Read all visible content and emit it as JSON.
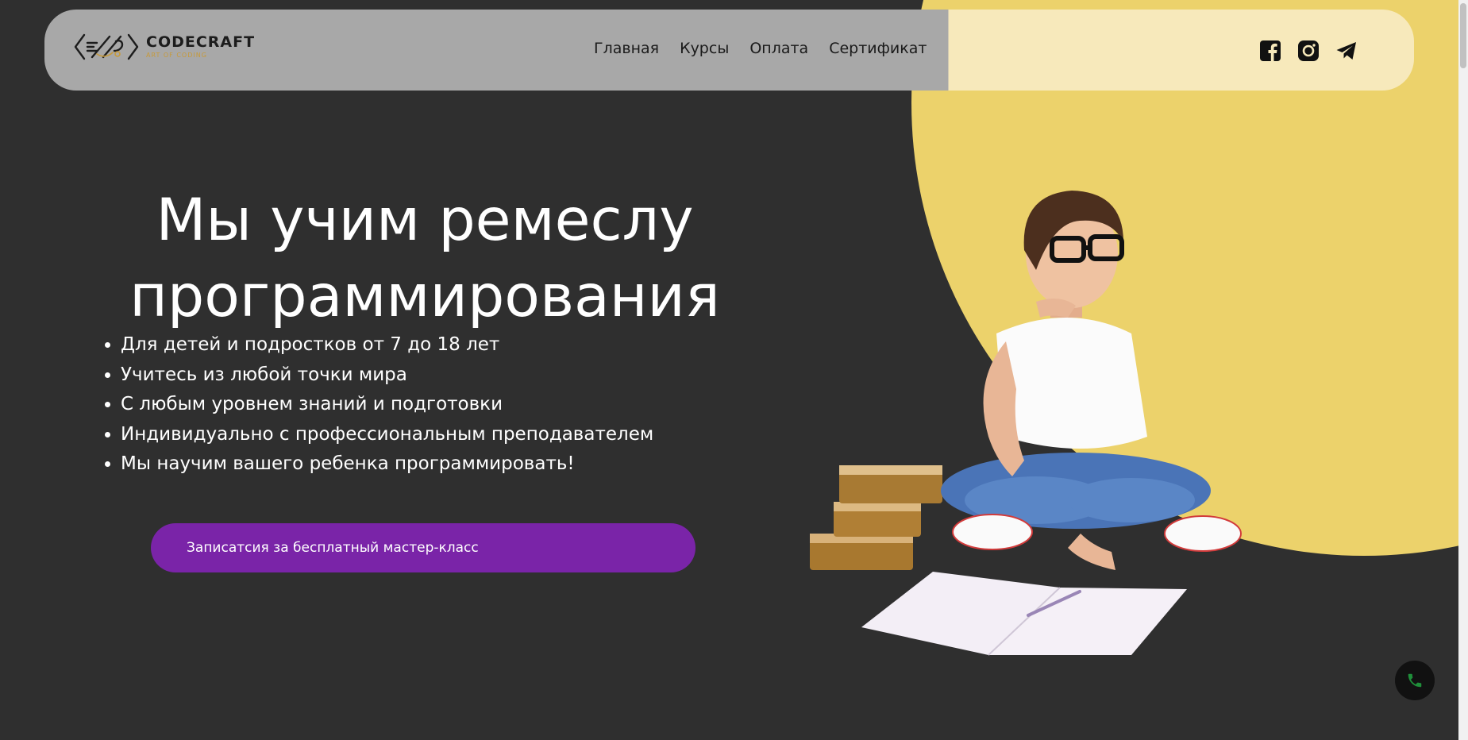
{
  "header": {
    "logo": {
      "title": "CODECRAFT",
      "subtitle": "ART OF CODING"
    },
    "nav": [
      {
        "label": "Главная"
      },
      {
        "label": "Курсы"
      },
      {
        "label": "Оплата"
      },
      {
        "label": "Сертификат"
      }
    ],
    "socials": [
      {
        "icon": "facebook-icon"
      },
      {
        "icon": "instagram-icon"
      },
      {
        "icon": "telegram-icon"
      }
    ]
  },
  "hero": {
    "title_line1": "Мы учим ремеслу",
    "title_line2": "программирования",
    "features": [
      "Для детей и подростков от 7 до 18 лет",
      "Учитесь из любой точки мира",
      "С любым уровнем знаний и подготовки",
      "Индивидуально с профессиональным преподавателем",
      "Мы научим вашего ребенка программировать!"
    ],
    "cta_label": "Записатсия за бесплатный мастер-класс"
  },
  "colors": {
    "background": "#2f2f2f",
    "accent_yellow": "#ecd26b",
    "cta_purple": "#7a24a8",
    "header_gray": "#a8a8a8",
    "header_cream": "#f7e9bb",
    "phone_icon": "#1f8f3a"
  },
  "floating": {
    "phone_icon": "phone-icon"
  }
}
